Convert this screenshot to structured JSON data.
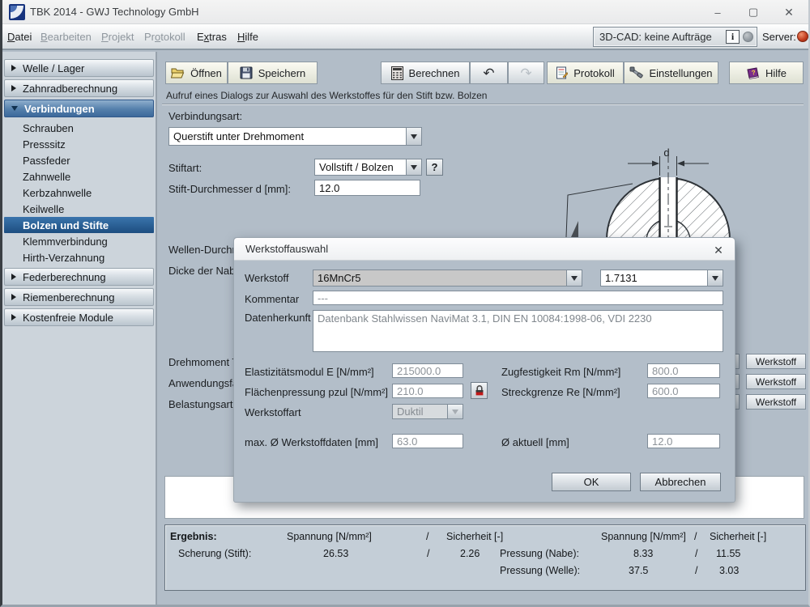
{
  "colors": {
    "content_bg": "#b2bdc8",
    "accent_blue": "#3c699b",
    "selected_blue": "#1d4e80",
    "server_led_red": "#c03a1c",
    "cad_led_gray": "#8d959c",
    "lock_red": "#cc2222"
  },
  "window": {
    "title": "TBK 2014 - GWJ Technology GmbH",
    "minimize_glyph": "–",
    "maximize_glyph": "▢",
    "close_glyph": "✕"
  },
  "menubar": {
    "items": [
      {
        "pre": "",
        "key": "D",
        "post": "atei",
        "enabled": true
      },
      {
        "pre": "",
        "key": "B",
        "post": "earbeiten",
        "enabled": false
      },
      {
        "pre": "",
        "key": "P",
        "post": "rojekt",
        "enabled": false
      },
      {
        "pre": "Pr",
        "key": "o",
        "post": "tokoll",
        "enabled": false
      },
      {
        "pre": "E",
        "key": "x",
        "post": "tras",
        "enabled": true
      },
      {
        "pre": "",
        "key": "H",
        "post": "ilfe",
        "enabled": true
      }
    ],
    "cad_status": "3D-CAD: keine Aufträge",
    "info_label": "i",
    "server_label": "Server:"
  },
  "sidebar": {
    "headers": [
      "Welle / Lager",
      "Zahnradberechnung",
      "Verbindungen",
      "Federberechnung",
      "Riemenberechnung",
      "Kostenfreie Module"
    ],
    "verbindungen_items": [
      "Schrauben",
      "Presssitz",
      "Passfeder",
      "Zahnwelle",
      "Kerbzahnwelle",
      "Keilwelle",
      "Bolzen und Stifte",
      "Klemmverbindung",
      "Hirth-Verzahnung"
    ],
    "selected_item": "Bolzen und Stifte"
  },
  "toolbar": {
    "open": "Öffnen",
    "save": "Speichern",
    "calculate": "Berechnen",
    "undo_glyph": "↶",
    "redo_glyph": "↷",
    "protocol": "Protokoll",
    "settings": "Einstellungen",
    "help": "Hilfe",
    "hint": "Aufruf eines Dialogs zur Auswahl des Werkstoffes für den Stift bzw. Bolzen"
  },
  "form": {
    "verbindungsart_label": "Verbindungsart:",
    "verbindungsart_value": "Querstift unter Drehmoment",
    "stiftart_label": "Stiftart:",
    "stiftart_value": "Vollstift / Bolzen",
    "stiftart_help": "?",
    "durchmesser_label": "Stift-Durchmesser d [mm]:",
    "durchmesser_value": "12.0",
    "wellen_label": "Wellen-Durchm",
    "dicke_label": "Dicke der Nab",
    "drehmoment_label": "Drehmoment T",
    "anwendung_label": "Anwendungsfa",
    "belastung_label": "Belastungsart:",
    "werkstoff_button": "Werkstoff"
  },
  "drawing": {
    "dim_label": "d"
  },
  "dialog": {
    "title": "Werkstoffauswahl",
    "close_glyph": "✕",
    "werkstoff_label": "Werkstoff",
    "werkstoff_value": "16MnCr5",
    "werkstoff_number": "1.7131",
    "kommentar_label": "Kommentar",
    "kommentar_value": "---",
    "datenherkunft_label": "Datenherkunft",
    "datenherkunft_value": "Datenbank Stahlwissen NaviMat 3.1, DIN EN 10084:1998-06, VDI 2230",
    "emodul_label": "Elastizitätsmodul E [N/mm²]",
    "emodul_value": "215000.0",
    "pressung_label": "Flächenpressung pzul [N/mm²]",
    "pressung_value": "210.0",
    "werkstoffart_label": "Werkstoffart",
    "werkstoffart_value": "Duktil",
    "maxd_label": "max. Ø Werkstoffdaten [mm]",
    "maxd_value": "63.0",
    "zugfestigkeit_label": "Zugfestigkeit Rm [N/mm²]",
    "zugfestigkeit_value": "800.0",
    "streckgrenze_label": "Streckgrenze Re [N/mm²]",
    "streckgrenze_value": "600.0",
    "daktuell_label": "Ø aktuell [mm]",
    "daktuell_value": "12.0",
    "ok": "OK",
    "cancel": "Abbrechen"
  },
  "results": {
    "title": "Ergebnis:",
    "col_spannung": "Spannung [N/mm²]",
    "col_sicherheit": "Sicherheit [-]",
    "slash": "/",
    "rows_left": [
      {
        "label": "Scherung (Stift):",
        "spannung": "26.53",
        "sicherheit": "2.26"
      }
    ],
    "rows_right": [
      {
        "label": "Pressung (Nabe):",
        "spannung": "8.33",
        "sicherheit": "11.55"
      },
      {
        "label": "Pressung (Welle):",
        "spannung": "37.5",
        "sicherheit": "3.03"
      }
    ]
  }
}
